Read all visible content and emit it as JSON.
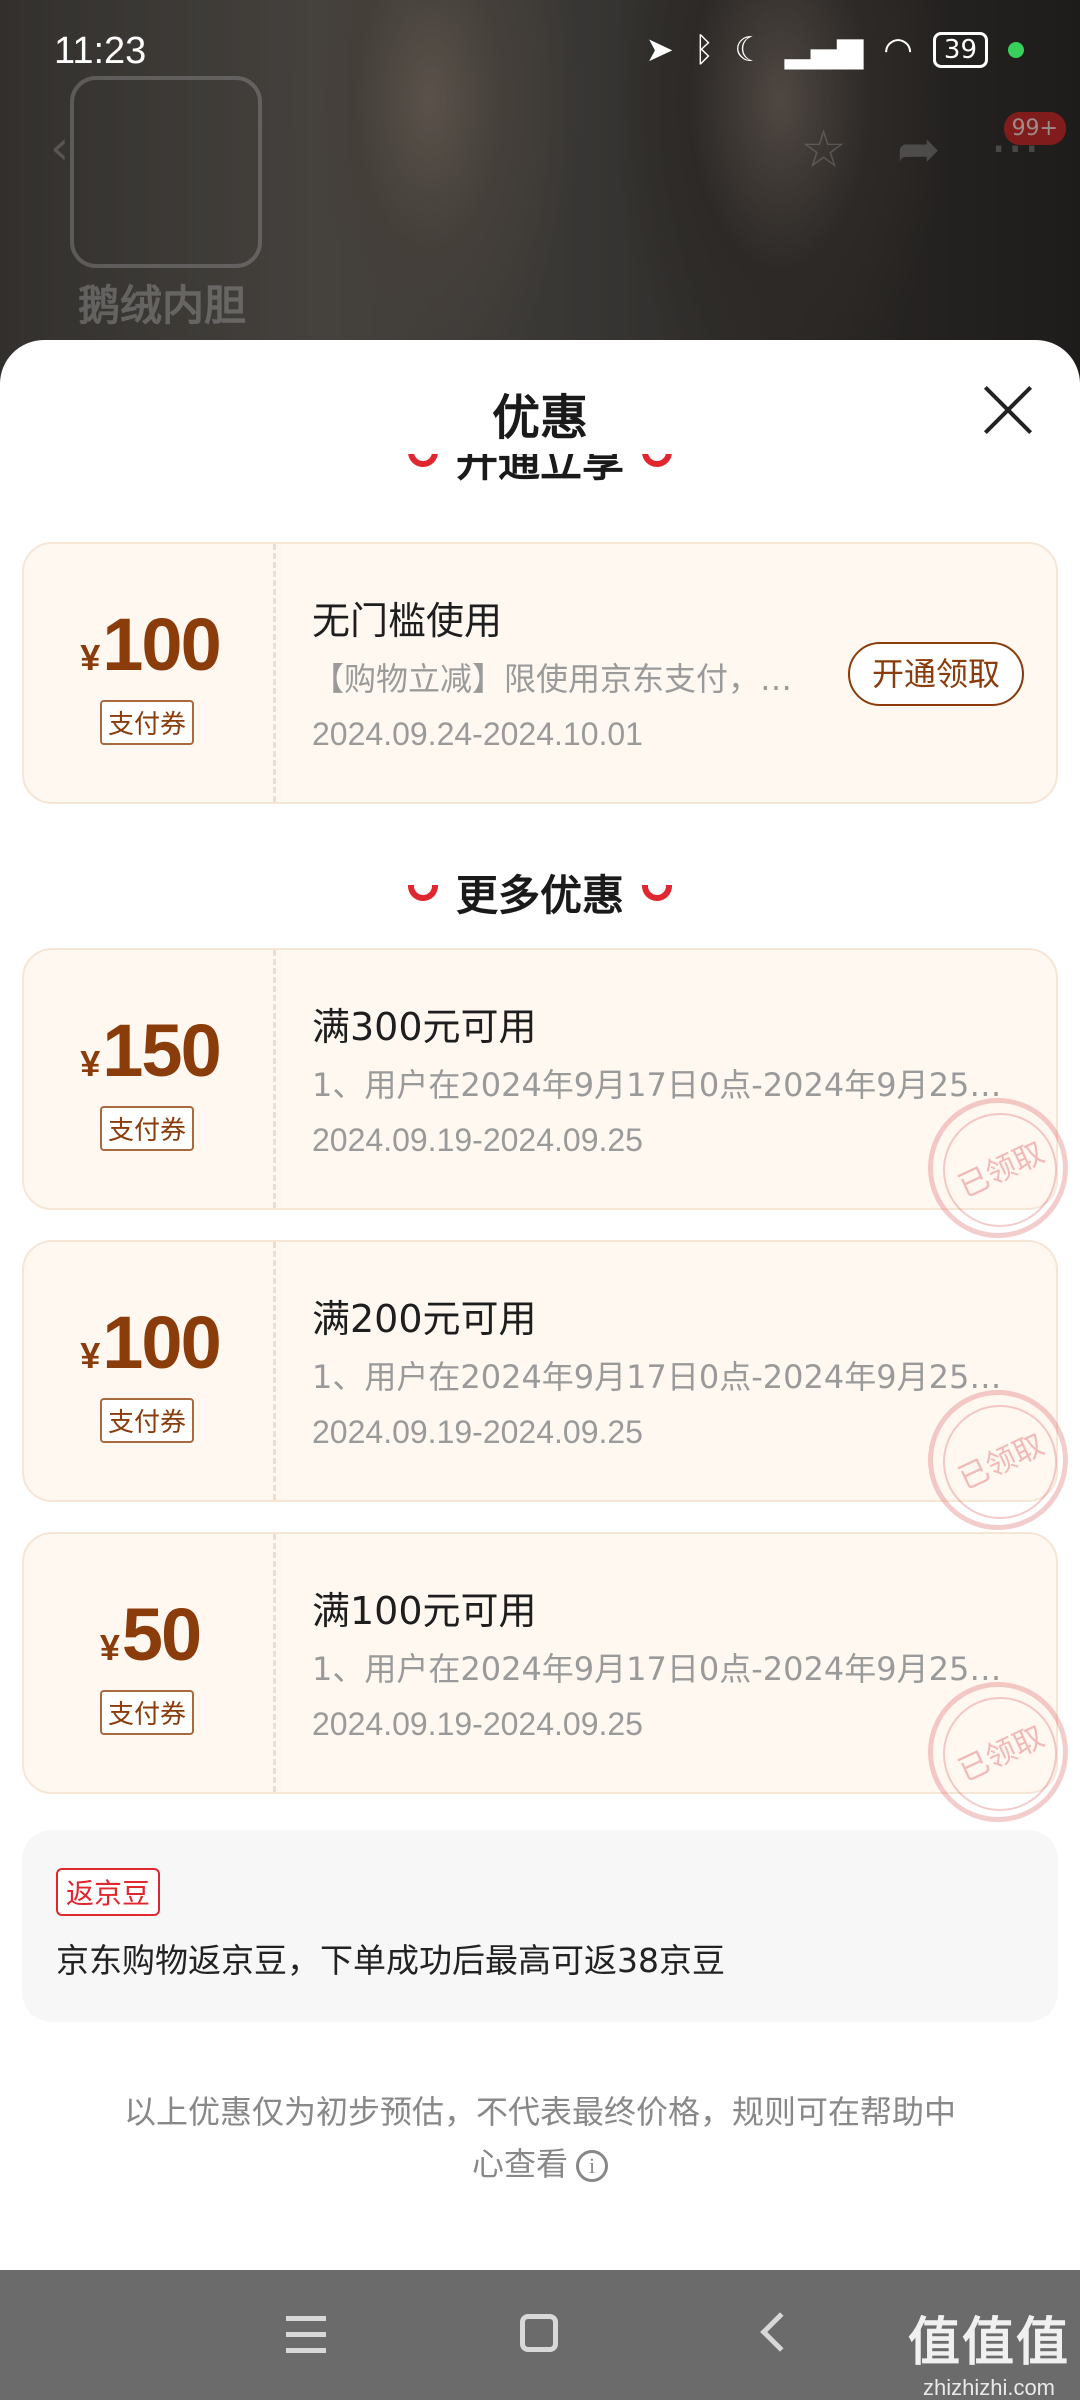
{
  "status_bar": {
    "time": "11:23",
    "battery": "39",
    "icons": [
      "location-icon",
      "bluetooth-icon",
      "moon-icon",
      "hd-signal-icon",
      "wifi-icon",
      "battery-icon"
    ]
  },
  "background": {
    "logo_text": "鹅绒内胆",
    "badge": "99+"
  },
  "sheet": {
    "title": "优惠",
    "section_open": "开通立享",
    "section_more": "更多优惠"
  },
  "coupons": [
    {
      "currency": "¥",
      "amount": "100",
      "tag": "支付券",
      "title": "无门槛使用",
      "desc": "【购物立减】限使用京东支付，…",
      "date": "2024.09.24-2024.10.01",
      "action": "开通领取"
    },
    {
      "currency": "¥",
      "amount": "150",
      "tag": "支付券",
      "title": "满300元可用",
      "desc": "1、用户在2024年9月17日0点-2024年9月25日…",
      "date": "2024.09.19-2024.09.25",
      "stamp": "已领取"
    },
    {
      "currency": "¥",
      "amount": "100",
      "tag": "支付券",
      "title": "满200元可用",
      "desc": "1、用户在2024年9月17日0点-2024年9月25日…",
      "date": "2024.09.19-2024.09.25",
      "stamp": "已领取"
    },
    {
      "currency": "¥",
      "amount": "50",
      "tag": "支付券",
      "title": "满100元可用",
      "desc": "1、用户在2024年9月17日0点-2024年9月25日…",
      "date": "2024.09.19-2024.09.25",
      "stamp": "已领取"
    }
  ],
  "beans": {
    "tag": "返京豆",
    "text": "京东购物返京豆，下单成功后最高可返38京豆"
  },
  "footnote": "以上优惠仅为初步预估，不代表最终价格，规则可在帮助中心查看",
  "watermark": {
    "main": "值值值",
    "sub": "zhizhizhi.com"
  },
  "colors": {
    "accent_red": "#e0262e",
    "coupon_brown": "#8a3c0a",
    "coupon_bg": "#fff8f1"
  }
}
